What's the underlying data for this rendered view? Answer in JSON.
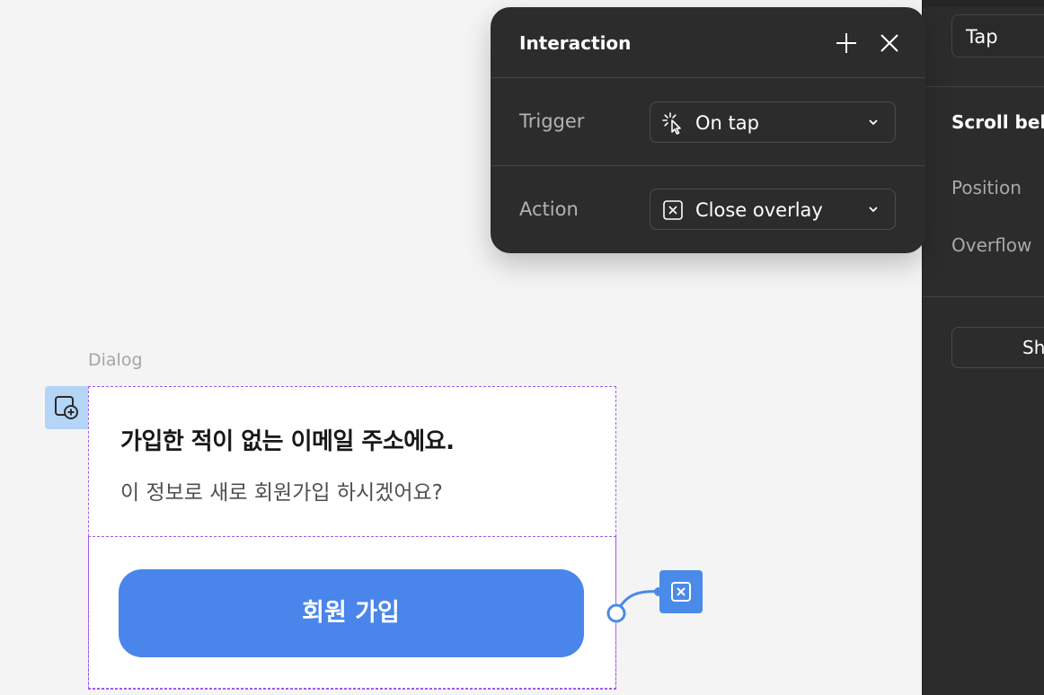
{
  "interaction_panel": {
    "title": "Interaction",
    "trigger": {
      "label": "Trigger",
      "value": "On tap",
      "icon": "tap-cursor-icon"
    },
    "action": {
      "label": "Action",
      "value": "Close overlay",
      "icon": "close-overlay-icon"
    }
  },
  "properties_panel": {
    "trigger_value": "Tap",
    "scroll_heading": "Scroll beh",
    "position_label": "Position",
    "overflow_label": "Overflow",
    "button_label": "Sh"
  },
  "canvas": {
    "frame_label": "Dialog",
    "dialog": {
      "title": "가입한 적이 없는 이메일 주소에요.",
      "subtitle": "이 정보로 새로 회원가입 하시겠어요?",
      "button_label": "회원 가입"
    }
  },
  "colors": {
    "panel_bg": "#2c2c2c",
    "canvas_bg": "#f4f4f4",
    "button_blue": "#4985ea",
    "selection_purple": "#9e5bea",
    "badge_blue": "#b5d5f7"
  }
}
